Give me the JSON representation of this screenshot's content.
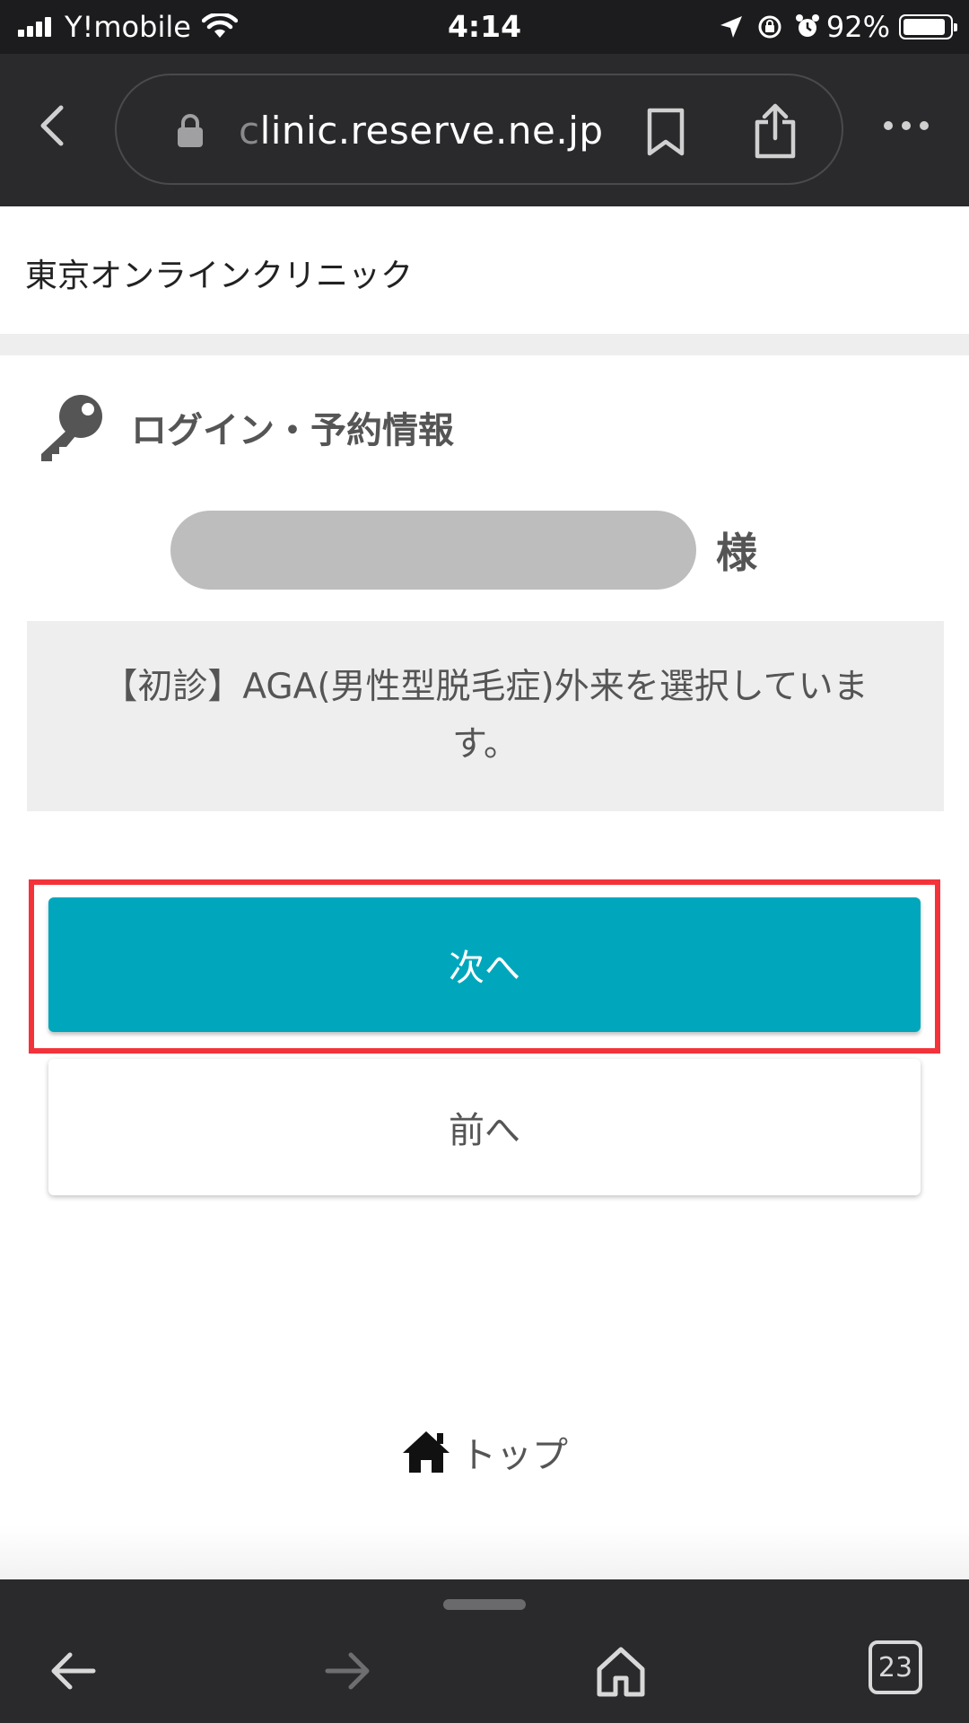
{
  "status_bar": {
    "carrier": "Y!mobile",
    "time": "4:14",
    "battery_percent": "92%",
    "battery_level": 0.92
  },
  "browser": {
    "url_faded": "c",
    "url_main": "linic.reserve.ne.jp"
  },
  "site": {
    "title": "東京オンラインクリニック"
  },
  "section": {
    "title": "ログイン・予約情報"
  },
  "patient": {
    "honorific": "様"
  },
  "info": {
    "message": "【初診】AGA(男性型脱毛症)外来を選択しています。"
  },
  "buttons": {
    "next": "次へ",
    "prev": "前へ"
  },
  "footer": {
    "top_link": "トップ"
  },
  "toolbar": {
    "tab_count": "23"
  },
  "colors": {
    "accent": "#00a7bc",
    "highlight": "#f4323a"
  }
}
